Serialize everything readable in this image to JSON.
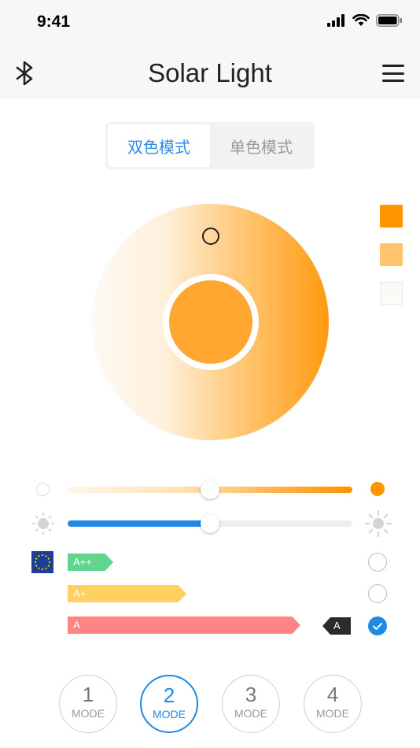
{
  "status_bar": {
    "time": "9:41"
  },
  "nav": {
    "title": "Solar Light",
    "left_icon": "bluetooth-icon",
    "right_icon": "menu-icon"
  },
  "segment": {
    "tabs": [
      {
        "label": "双色模式",
        "active": true
      },
      {
        "label": "单色模式",
        "active": false
      }
    ]
  },
  "color_wheel": {
    "center_color": "#ffa730",
    "gradient_start": "#fdfaf5",
    "gradient_end": "#ff9a10"
  },
  "swatches": [
    "#ff9500",
    "#ffc46b",
    "#fbfaf7"
  ],
  "sliders": {
    "color_temperature": {
      "value_percent": 50
    },
    "brightness": {
      "value_percent": 50
    }
  },
  "energy_labels": [
    {
      "label": "A++",
      "color": "#5fd58d",
      "selected": false
    },
    {
      "label": "A+",
      "color": "#ffcf60",
      "selected": false
    },
    {
      "label": "A",
      "color": "#ff8585",
      "selected": true
    }
  ],
  "current_rating": "A",
  "modes": [
    {
      "number": "1",
      "label": "MODE",
      "active": false
    },
    {
      "number": "2",
      "label": "MODE",
      "active": true
    },
    {
      "number": "3",
      "label": "MODE",
      "active": false
    },
    {
      "number": "4",
      "label": "MODE",
      "active": false
    }
  ],
  "accent_color": "#1e8ae6"
}
